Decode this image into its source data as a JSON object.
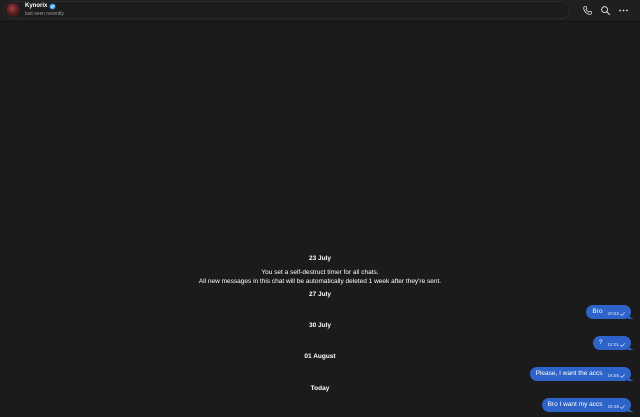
{
  "header": {
    "contact_name": "Kynorix",
    "status": "last seen recently",
    "icons": {
      "verified": "verified-badge-icon",
      "call": "phone-icon",
      "search": "search-icon",
      "more": "more-horizontal-icon"
    }
  },
  "timeline": {
    "date_23_july": "23 July",
    "service_line1": "You set a self-destruct timer for all chats.",
    "service_line2": "All new messages in this chat will be automatically deleted 1 week after they're sent.",
    "date_27_july": "27 July",
    "date_30_july": "30 July",
    "date_01_august": "01 August",
    "date_today": "Today"
  },
  "messages": [
    {
      "text": "Bro",
      "time": "20:52"
    },
    {
      "text": "?",
      "time": "12:01"
    },
    {
      "text": "Please, I want the accs",
      "time": "16:55"
    },
    {
      "text": "Bro I want my accs",
      "time": "19:38"
    }
  ],
  "colors": {
    "background": "#1b1b1b",
    "outgoing_bubble": "#2e63c9",
    "header": "#1f1f1f"
  }
}
